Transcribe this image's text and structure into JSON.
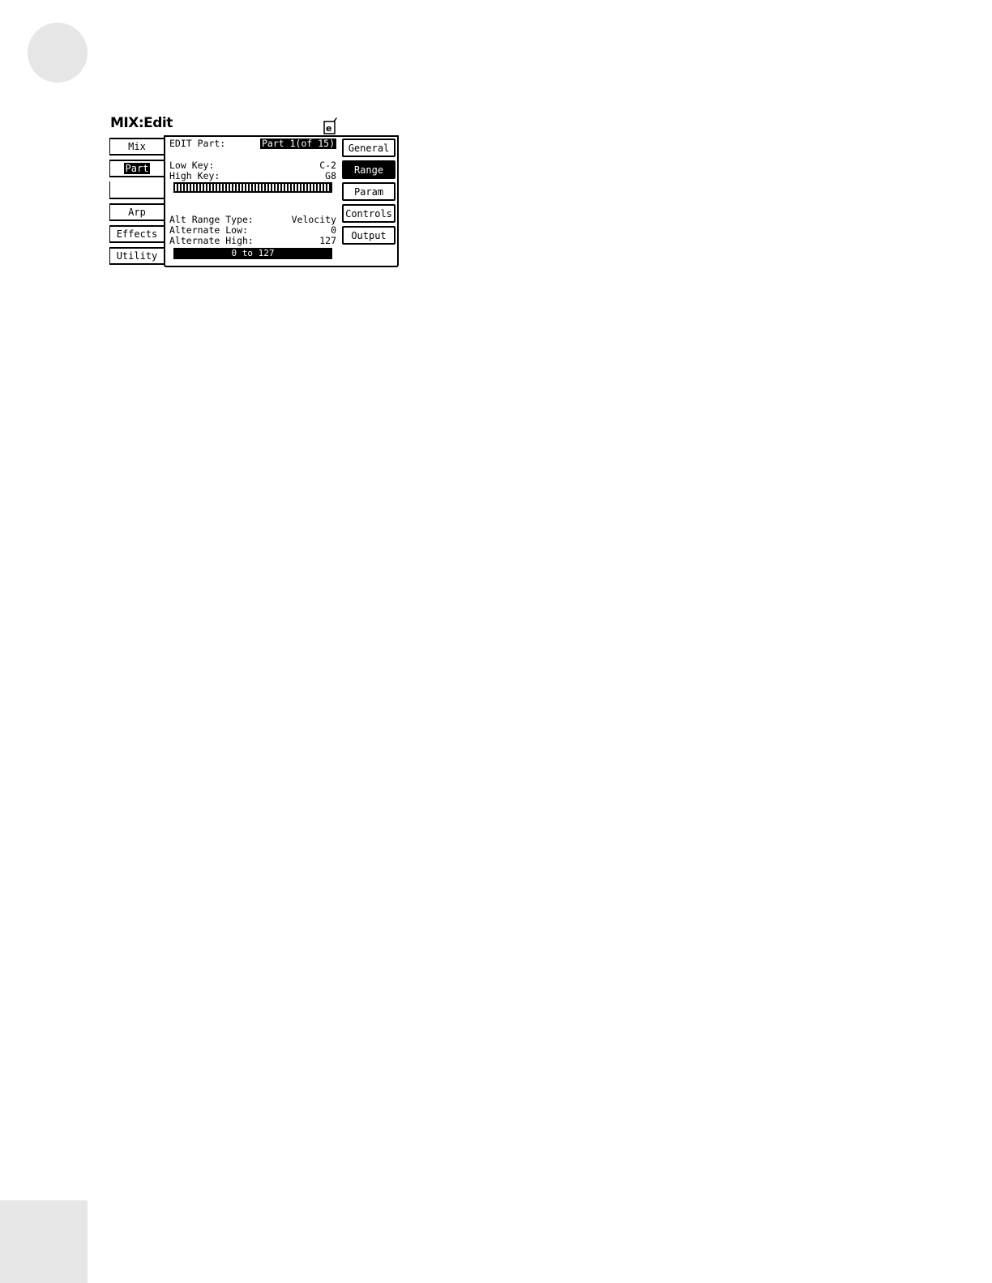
{
  "screen": {
    "title": "MIX:Edit",
    "header_icon": "edit-page-icon"
  },
  "left_tabs": [
    {
      "label": "Mix",
      "selected": false
    },
    {
      "label": "Part",
      "selected": true
    },
    {
      "label": "",
      "selected": false
    },
    {
      "label": "Arp",
      "selected": false
    },
    {
      "label": "Effects",
      "selected": false
    },
    {
      "label": "Utility",
      "selected": false
    }
  ],
  "panel": {
    "edit_part_label": "EDIT Part:",
    "edit_part_value": "Part 1(of 15)",
    "low_key_label": "Low Key:",
    "low_key_value": "C-2",
    "high_key_label": "High Key:",
    "high_key_value": "G8",
    "alt_range_type_label": "Alt Range Type:",
    "alt_range_type_value": "Velocity",
    "alternate_low_label": "Alternate Low:",
    "alternate_low_value": "0",
    "alternate_high_label": "Alternate High:",
    "alternate_high_value": "127",
    "range_bar_text": "0 to 127"
  },
  "right_buttons": [
    {
      "label": "General",
      "active": false
    },
    {
      "label": "Range",
      "active": true
    },
    {
      "label": "Param",
      "active": false
    },
    {
      "label": "Controls",
      "active": false
    },
    {
      "label": "Output",
      "active": false
    }
  ]
}
